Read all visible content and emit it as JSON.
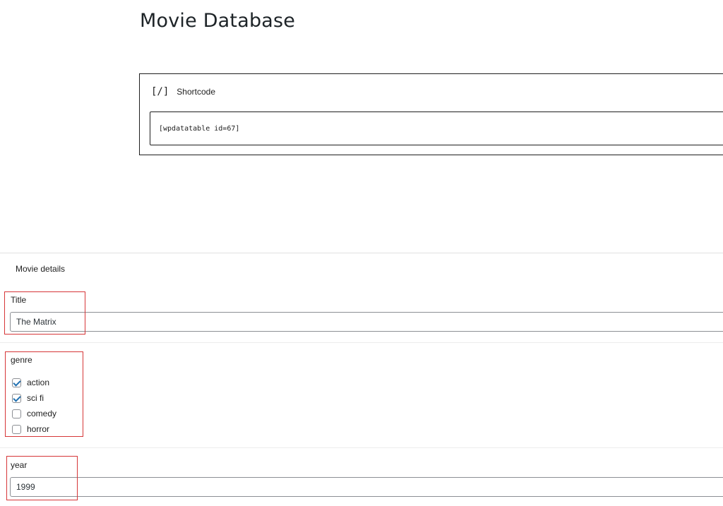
{
  "page": {
    "title": "Movie Database"
  },
  "shortcode": {
    "icon": "[/]",
    "label": "Shortcode",
    "value": "[wpdatatable id=67]"
  },
  "metabox": {
    "title": "Movie details",
    "fields": {
      "title": {
        "label": "Title",
        "value": "The Matrix"
      },
      "genre": {
        "label": "genre",
        "options": [
          {
            "label": "action",
            "checked": true
          },
          {
            "label": "sci fi",
            "checked": true
          },
          {
            "label": "comedy",
            "checked": false
          },
          {
            "label": "horror",
            "checked": false
          }
        ]
      },
      "year": {
        "label": "year",
        "value": "1999"
      }
    }
  },
  "colors": {
    "highlight": "#d63638",
    "checkmark": "#2271b1"
  }
}
